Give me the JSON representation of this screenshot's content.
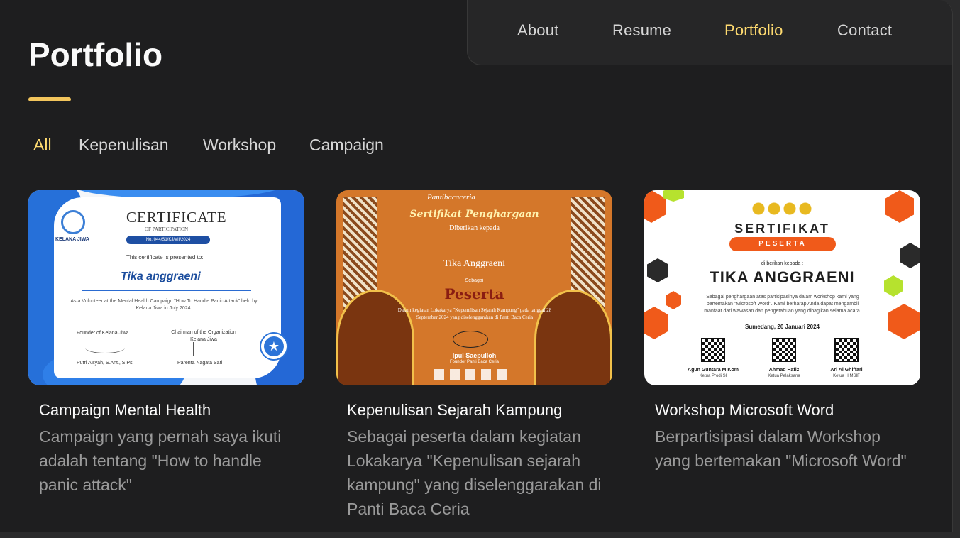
{
  "nav": {
    "items": [
      {
        "label": "About",
        "active": false
      },
      {
        "label": "Resume",
        "active": false
      },
      {
        "label": "Portfolio",
        "active": true
      },
      {
        "label": "Contact",
        "active": false
      }
    ]
  },
  "page": {
    "title": "Portfolio"
  },
  "filters": [
    {
      "label": "All",
      "active": true
    },
    {
      "label": "Kepenulisan",
      "active": false
    },
    {
      "label": "Workshop",
      "active": false
    },
    {
      "label": "Campaign",
      "active": false
    }
  ],
  "projects": [
    {
      "title": "Campaign Mental Health",
      "description": "Campaign yang pernah saya ikuti adalah tentang \"How to handle panic attack\"",
      "image": {
        "org": "KELANA JIWA",
        "heading": "CERTIFICATE",
        "subheading": "OF PARTICIPATION",
        "number": "No. 044/S1/KJ/VII/2024",
        "presented": "This certificate is presented to:",
        "name": "Tika anggraeni",
        "body": "As a Volunteer at the Mental Health Campaign \"How To Handle Panic Attack\" held by Kelana Jiwa in July 2024.",
        "founder_title": "Founder of Kelana Jiwa",
        "chair_title": "Chairman of the Organization Kelana Jiwa",
        "founder_name": "Putri Aisyah, S.Ant., S.Psi",
        "chair_name": "Parenta Nagata Sari"
      }
    },
    {
      "title": "Kepenulisan Sejarah Kampung",
      "description": "Sebagai peserta dalam kegiatan Lokakarya \"Kepenulisan sejarah kampung\" yang diselenggarakan di Panti Baca Ceria",
      "image": {
        "brand": "Pantibacaceria",
        "heading": "Sertifikat Penghargaan",
        "subheading": "Diberikan kepada",
        "name": "Tika Anggraeni",
        "as": "Sebagai",
        "role": "Peserta",
        "body": "Dalam kegiatan Lokakarya \"Kepenulisan Sejarah Kampung\" pada tanggal 28 September 2024 yang diselenggarakan di Panti Baca Ceria",
        "signer": "Ipul Saepulloh",
        "signer_role": "Founder Panti Baca Ceria"
      }
    },
    {
      "title": "Workshop Microsoft Word",
      "description": "Berpartisipasi dalam Workshop yang bertemakan \"Microsoft Word\"",
      "image": {
        "heading": "SERTIFIKAT",
        "pill": "PESERTA",
        "given": "di berikan kepada :",
        "name": "TIKA ANGGRAENI",
        "body": "Sebagai penghargaan atas partisipasinya dalam workshop kami yang bertemakan \"Microsoft Word\". Kami berharap Anda dapat mengambil manfaat dari wawasan dan pengetahuan yang dibagikan selama acara.",
        "date": "Sumedang, 20 Januari 2024",
        "signers": [
          {
            "name": "Agun Guntara M.Kom",
            "role": "Ketua Prodi SI"
          },
          {
            "name": "Ahmad Hafiz",
            "role": "Ketua Pelaksana"
          },
          {
            "name": "Ari Al Ghiffari",
            "role": "Ketua HIMSIF"
          }
        ]
      }
    }
  ],
  "colors": {
    "accent": "#ffdb70",
    "background": "#1e1e1f",
    "text": "#fafafa",
    "muted": "#9a9a9a"
  }
}
